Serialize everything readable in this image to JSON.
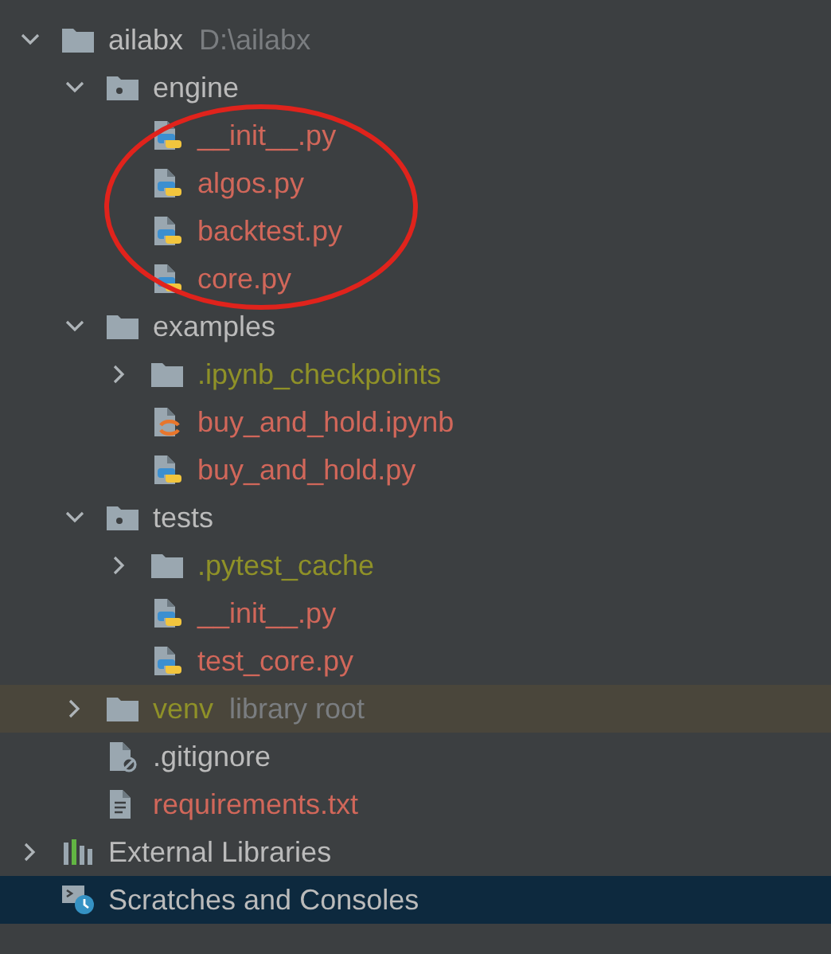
{
  "project_tree": [
    {
      "kind": "folder",
      "label": "ailabx",
      "hint": "D:\\ailabx",
      "color": "#bbbbbb",
      "expanded": true,
      "selected": false,
      "children": [
        {
          "kind": "module",
          "label": "engine",
          "color": "#bbbbbb",
          "expanded": true,
          "selected": false,
          "children": [
            {
              "kind": "py",
              "label": "__init__.py",
              "color": "#d1675a",
              "selected": false
            },
            {
              "kind": "py",
              "label": "algos.py",
              "color": "#d1675a",
              "selected": false
            },
            {
              "kind": "py",
              "label": "backtest.py",
              "color": "#d1675a",
              "selected": false
            },
            {
              "kind": "py",
              "label": "core.py",
              "color": "#d1675a",
              "selected": false
            }
          ]
        },
        {
          "kind": "folder",
          "label": "examples",
          "color": "#bbbbbb",
          "expanded": true,
          "selected": false,
          "children": [
            {
              "kind": "folder",
              "label": ".ipynb_checkpoints",
              "color": "#8f9128",
              "expanded": false,
              "selected": false
            },
            {
              "kind": "ipynb",
              "label": "buy_and_hold.ipynb",
              "color": "#d1675a",
              "selected": false
            },
            {
              "kind": "py",
              "label": "buy_and_hold.py",
              "color": "#d1675a",
              "selected": false
            }
          ]
        },
        {
          "kind": "module",
          "label": "tests",
          "color": "#bbbbbb",
          "expanded": true,
          "selected": false,
          "children": [
            {
              "kind": "folder",
              "label": ".pytest_cache",
              "color": "#8f9128",
              "expanded": false,
              "selected": false
            },
            {
              "kind": "py",
              "label": "__init__.py",
              "color": "#d1675a",
              "selected": false
            },
            {
              "kind": "py",
              "label": "test_core.py",
              "color": "#d1675a",
              "selected": false
            }
          ]
        },
        {
          "kind": "folder",
          "label": "venv",
          "hint": "library root",
          "color": "#8f9128",
          "expanded": false,
          "excluded": true,
          "selected": false
        },
        {
          "kind": "gitignore",
          "label": ".gitignore",
          "color": "#bbbbbb",
          "selected": false
        },
        {
          "kind": "txt",
          "label": "requirements.txt",
          "color": "#d1675a",
          "selected": false
        }
      ]
    },
    {
      "kind": "libraries",
      "label": "External Libraries",
      "color": "#bbbbbb",
      "expanded": false,
      "selected": false
    },
    {
      "kind": "scratches",
      "label": "Scratches and Consoles",
      "color": "#bbbbbb",
      "selected": true
    }
  ],
  "annotation": {
    "kind": "ellipse"
  }
}
